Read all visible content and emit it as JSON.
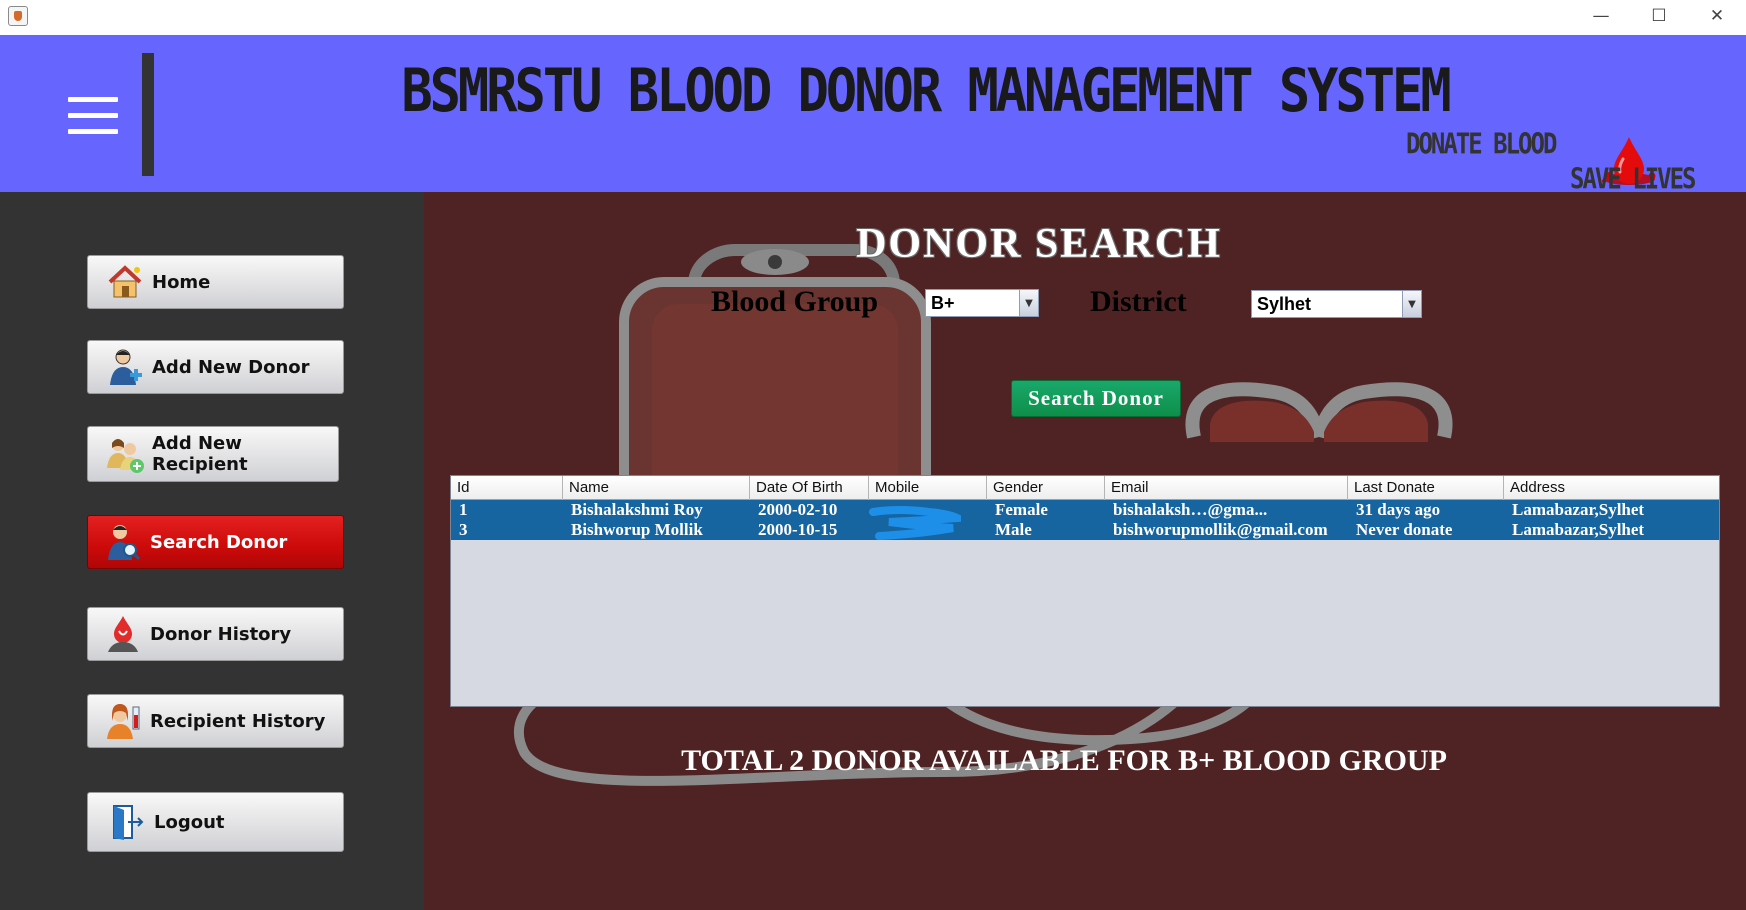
{
  "window": {
    "minimize_glyph": "—",
    "maximize_glyph": "☐",
    "close_glyph": "✕"
  },
  "header": {
    "title": "BSMRSTU BLOOD DONOR MANAGEMENT SYSTEM",
    "donate_blood": "DONATE BLOOD",
    "save_lives": "SAVE LIVES",
    "icons": [
      "hamburger-menu-icon",
      "blood-drop-icon"
    ]
  },
  "sidebar": {
    "items": [
      {
        "label": "Home",
        "icon": "home-icon",
        "active": false
      },
      {
        "label": "Add New Donor",
        "icon": "add-donor-icon",
        "active": false
      },
      {
        "label": "Add New Recipient",
        "icon": "add-recipient-icon",
        "active": false
      },
      {
        "label": "Search Donor",
        "icon": "search-donor-icon",
        "active": true
      },
      {
        "label": "Donor History",
        "icon": "donor-history-icon",
        "active": false
      },
      {
        "label": "Recipient History",
        "icon": "recipient-history-icon",
        "active": false
      },
      {
        "label": "Logout",
        "icon": "logout-icon",
        "active": false
      }
    ]
  },
  "main": {
    "title": "DONOR  SEARCH",
    "blood_group_label": "Blood Group",
    "blood_group_value": "B+",
    "district_label": "District",
    "district_value": "Sylhet",
    "search_button": "Search Donor",
    "table": {
      "columns": [
        "Id",
        "Name",
        "Date Of Birth",
        "Mobile",
        "Gender",
        "Email",
        "Last Donate",
        "Address"
      ],
      "rows": [
        [
          "1",
          "Bishalakshmi Roy",
          "2000-02-10",
          "",
          "Female",
          "bishalaksh…@gma...",
          "31 days ago",
          "Lamabazar,Sylhet"
        ],
        [
          "3",
          "Bishworup Mollik",
          "2000-10-15",
          "",
          "Male",
          "bishworupmollik@gmail.com",
          "Never donate",
          "Lamabazar,Sylhet"
        ]
      ]
    },
    "total_message": "TOTAL 2 DONOR AVAILABLE FOR B+ BLOOD GROUP"
  },
  "colors": {
    "header_bg": "#6666ff",
    "sidebar_bg": "#333333",
    "main_bg": "#4f2323",
    "active_button": "#cc0a0a",
    "search_button": "#0e8f4a",
    "selected_row": "#1765a0"
  }
}
